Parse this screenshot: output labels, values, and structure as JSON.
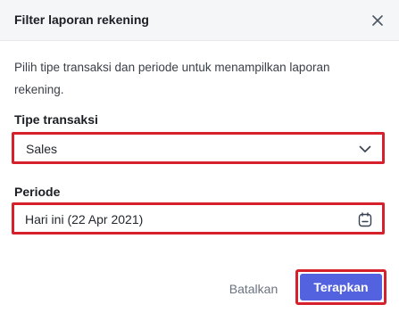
{
  "dialog": {
    "title": "Filter laporan rekening",
    "description": "Pilih tipe transaksi dan periode untuk menampilkan laporan rekening."
  },
  "transaction_type": {
    "label": "Tipe transaksi",
    "value": "Sales"
  },
  "period": {
    "label": "Periode",
    "value": "Hari ini (22 Apr 2021)"
  },
  "actions": {
    "cancel_label": "Batalkan",
    "apply_label": "Terapkan"
  },
  "colors": {
    "accent": "#5363df",
    "highlight_border": "#d6202b",
    "header_bg": "#f5f6f8"
  },
  "icons": {
    "close": "close-icon",
    "dropdown": "chevron-down-icon",
    "calendar": "calendar-icon"
  }
}
